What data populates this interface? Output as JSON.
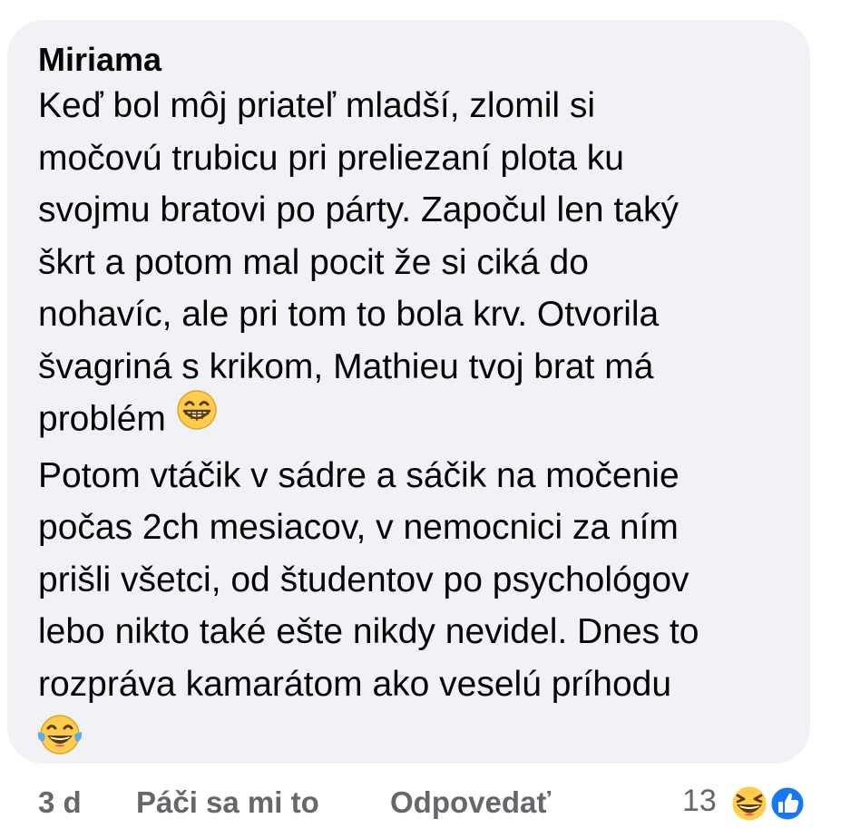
{
  "comment": {
    "author": "Miriama",
    "lines": [
      "Keď bol môj priateľ mladší, zlomil si",
      "močovú trubicu pri preliezaní plota ku",
      "svojmu bratovi po párty. Započul len taký",
      "škrt a potom mal pocit že si ciká do",
      "nohavíc, ale pri tom to bola krv. Otvorila",
      "švagriná s krikom, Mathieu tvoj brat má",
      "problém",
      "Potom vtáčik v sádre a sáčik na močenie",
      "počas 2ch mesiacov, v nemocnici za ním",
      "prišli všetci, od študentov po psychológov",
      "lebo nikto také ešte nikdy nevidel. Dnes to",
      "rozpráva kamarátom ako veselú príhodu"
    ],
    "emoji_after_line_7": "grinning-face-with-smiling-eyes-emoji",
    "emoji_final": "face-with-tears-of-joy-emoji"
  },
  "footer": {
    "time": "3 d",
    "like_label": "Páči sa mi to",
    "reply_label": "Odpovedať",
    "reaction_count": "13",
    "reaction_icons": [
      "laughing-reaction-icon",
      "like-reaction-icon"
    ]
  },
  "colors": {
    "bubble_bg": "#f0f2f5",
    "text": "#050505",
    "secondary": "#65676b",
    "like_blue": "#1877f2",
    "emoji_yellow": "#ffcc4d"
  }
}
